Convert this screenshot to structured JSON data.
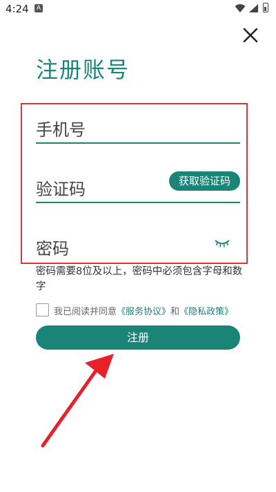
{
  "status_bar": {
    "time": "4:24",
    "notif_icon": "A"
  },
  "icons": {
    "close": "close-icon",
    "eye": "eye-closed-icon",
    "wifi": "wifi-icon",
    "signal": "signal-icon",
    "battery": "battery-icon"
  },
  "page": {
    "title": "注册账号"
  },
  "form": {
    "phone_placeholder": "手机号",
    "code_placeholder": "验证码",
    "get_code_label": "获取验证码",
    "password_placeholder": "密码",
    "password_hint": "密码需要8位及以上，密码中必须包含字母和数字"
  },
  "agreement": {
    "prefix": "我已阅读并同意",
    "service_link": "《服务协议》",
    "conjunction": "和",
    "privacy_link": "《隐私政策》"
  },
  "register_button": "注册",
  "colors": {
    "accent": "#1a8577",
    "highlight": "#e53238"
  }
}
